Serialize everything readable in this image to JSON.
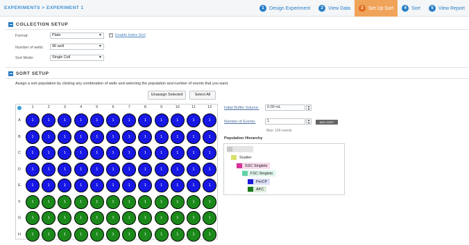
{
  "breadcrumb": "EXPERIMENTS > EXPERIMENT 1",
  "steps": [
    {
      "num": "1",
      "label": "Design Experiment"
    },
    {
      "num": "2",
      "label": "View Data"
    },
    {
      "num": "3",
      "label": "Set Up Sort",
      "active": true
    },
    {
      "num": "4",
      "label": "Sort"
    },
    {
      "num": "5",
      "label": "View Report"
    }
  ],
  "collection": {
    "title": "COLLECTION SETUP",
    "format_label": "Format:",
    "format_value": "Plate",
    "events_label": "Number of wells:",
    "events_value": "96 well",
    "mode_label": "Sort Mode:",
    "mode_value": "Single Cell",
    "index_label": "Enable Index Sort",
    "index_checked": true
  },
  "sort": {
    "title": "SORT SETUP",
    "instructions": "Assign a sort population by clicking any combination of wells and selecting the population and number of events that you want.",
    "unassign_label": "Unassign Selected",
    "select_all_label": "Select All",
    "columns": [
      "1",
      "2",
      "3",
      "4",
      "5",
      "6",
      "7",
      "8",
      "9",
      "10",
      "11",
      "12"
    ],
    "rows": [
      {
        "letter": "A",
        "color": "blue"
      },
      {
        "letter": "B",
        "color": "blue"
      },
      {
        "letter": "C",
        "color": "blue"
      },
      {
        "letter": "D",
        "color": "blue"
      },
      {
        "letter": "E",
        "color": "blue"
      },
      {
        "letter": "F",
        "color": "green"
      },
      {
        "letter": "G",
        "color": "green"
      },
      {
        "letter": "H",
        "color": "green"
      }
    ],
    "well_value": "1",
    "buffer_label": "Initial Buffer Volume:",
    "buffer_value": "0.00 mL",
    "events_label": "Number of Events:",
    "events_value": "1",
    "add_sort_label": "ADD SORT",
    "max_hint": "Max: 100 events",
    "hierarchy_title": "Population Hierarchy",
    "hierarchy": [
      {
        "label": "",
        "color": "#d6d6d6"
      },
      {
        "label": "Scatter",
        "color": "#d8e06a"
      },
      {
        "label": "SSC Singlets",
        "color": "#d6319a"
      },
      {
        "label": "FSC Singlets",
        "color": "#5fd1a6"
      },
      {
        "label": "PerCP",
        "color": "#1b1bd8"
      },
      {
        "label": "APC",
        "color": "#1e7a1e"
      }
    ]
  },
  "colors": {
    "accent": "#2a7ec5",
    "active_step": "#f0a45a",
    "well_blue": "#1717e6",
    "well_green": "#1b8a1b"
  }
}
